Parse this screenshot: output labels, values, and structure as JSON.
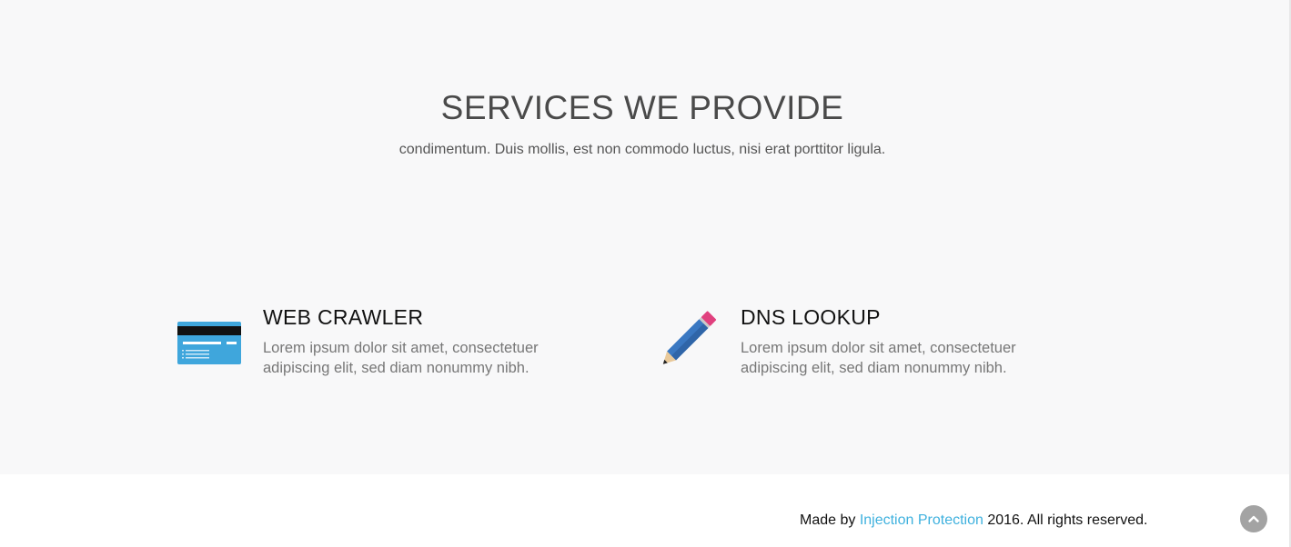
{
  "services": {
    "title": "SERVICES WE PROVIDE",
    "subtitle": "condimentum. Duis mollis, est non commodo luctus, nisi erat porttitor ligula.",
    "items": [
      {
        "icon": "credit-card-icon",
        "title": "WEB CRAWLER",
        "description": "Lorem ipsum dolor sit amet, consectetuer adipiscing elit, sed diam nonummy nibh."
      },
      {
        "icon": "pencil-icon",
        "title": "DNS LOOKUP",
        "description": "Lorem ipsum dolor sit amet, consectetuer adipiscing elit, sed diam nonummy nibh."
      }
    ]
  },
  "footer": {
    "prefix": "Made by ",
    "link_text": "Injection Protection",
    "suffix": " 2016. All rights reserved.",
    "link_color": "#3fb1de"
  },
  "back_to_top": {
    "icon": "chevron-up-icon"
  }
}
